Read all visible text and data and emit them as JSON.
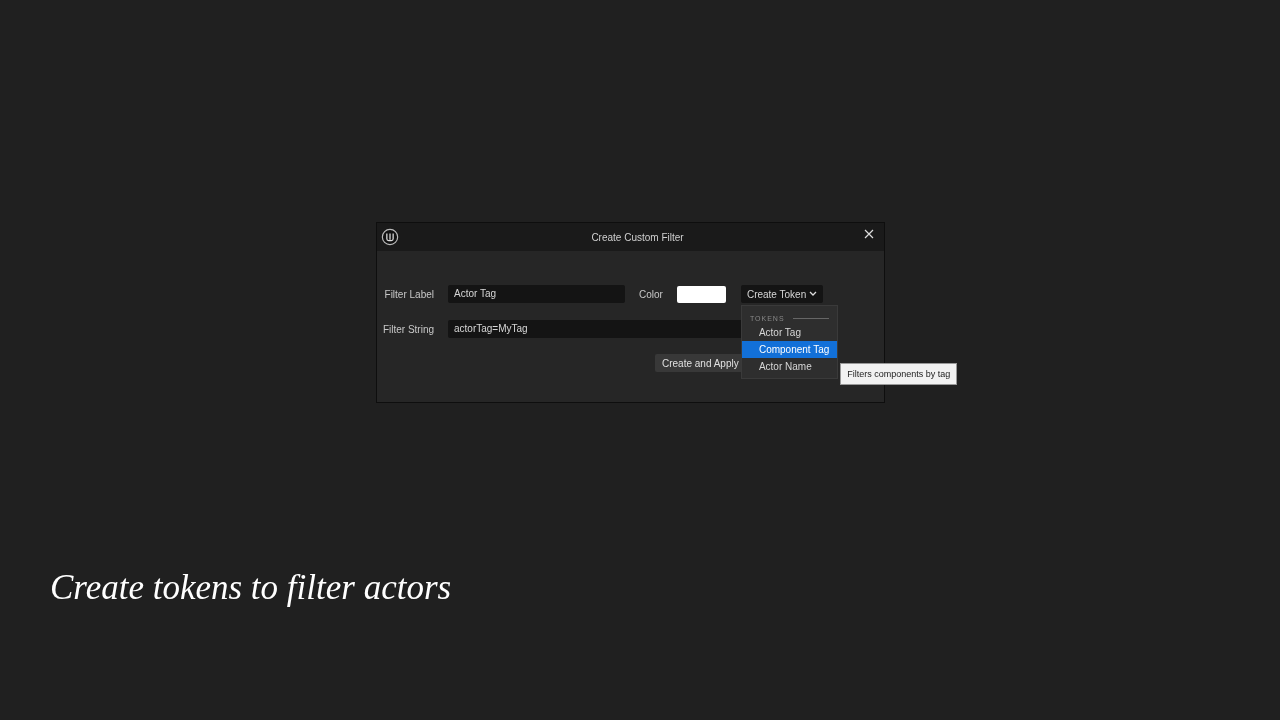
{
  "dialog": {
    "title": "Create Custom Filter",
    "filter_label": {
      "label": "Filter Label",
      "value": "Actor Tag"
    },
    "color": {
      "label": "Color",
      "color": "#ffffff"
    },
    "create_token": {
      "label": "Create Token",
      "expanded": true
    },
    "filter_string": {
      "label": "Filter String",
      "value": "actorTag=MyTag"
    },
    "token_menu": {
      "heading": "TOKENS",
      "items": [
        {
          "label": "Actor Tag",
          "selected": false
        },
        {
          "label": "Component Tag",
          "selected": true
        },
        {
          "label": "Actor Name",
          "selected": false
        }
      ]
    },
    "tooltip": "Filters components by tag",
    "buttons": [
      "Create and Apply"
    ]
  },
  "caption": "Create tokens to filter actors"
}
